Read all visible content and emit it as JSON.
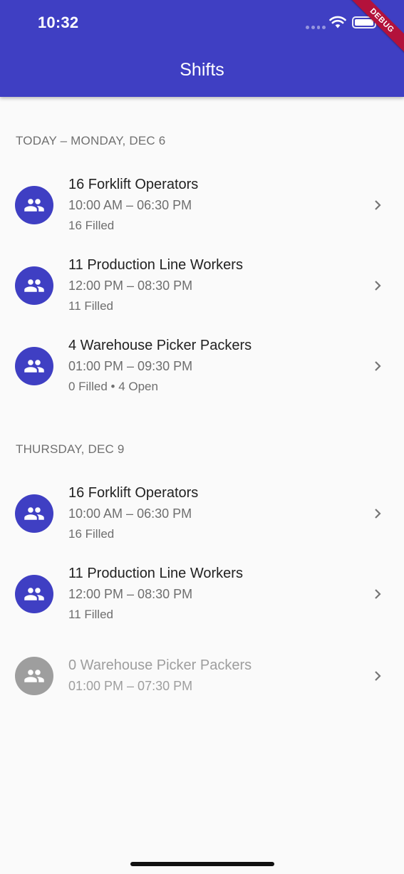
{
  "status_bar": {
    "time": "10:32",
    "debug_label": "DEBUG"
  },
  "app_bar": {
    "title": "Shifts",
    "color": "#3f3fc3"
  },
  "sections": [
    {
      "header": "TODAY – MONDAY, DEC 6",
      "shifts": [
        {
          "title": "16 Forklift Operators",
          "time": "10:00 AM – 06:30 PM",
          "status": "16 Filled",
          "icon": "group-icon"
        },
        {
          "title": "11 Production Line Workers",
          "time": "12:00 PM – 08:30 PM",
          "status": "11 Filled",
          "icon": "group-icon"
        },
        {
          "title": "4 Warehouse Picker Packers",
          "time": "01:00 PM – 09:30 PM",
          "status": "0 Filled • 4 Open",
          "icon": "group-icon"
        }
      ]
    },
    {
      "header": "THURSDAY, DEC 9",
      "shifts": [
        {
          "title": "16 Forklift Operators",
          "time": "10:00 AM – 06:30 PM",
          "status": "16 Filled",
          "icon": "group-icon"
        },
        {
          "title": "11 Production Line Workers",
          "time": "12:00 PM – 08:30 PM",
          "status": "11 Filled",
          "icon": "group-icon"
        },
        {
          "title": "0 Warehouse Picker Packers",
          "time": "01:00 PM – 07:30 PM",
          "status": "",
          "icon": "group-icon",
          "disabled": true
        }
      ]
    }
  ],
  "colors": {
    "accent": "#3f3fc3",
    "disabled": "#9e9e9e",
    "debug_banner": "#b3123b"
  }
}
